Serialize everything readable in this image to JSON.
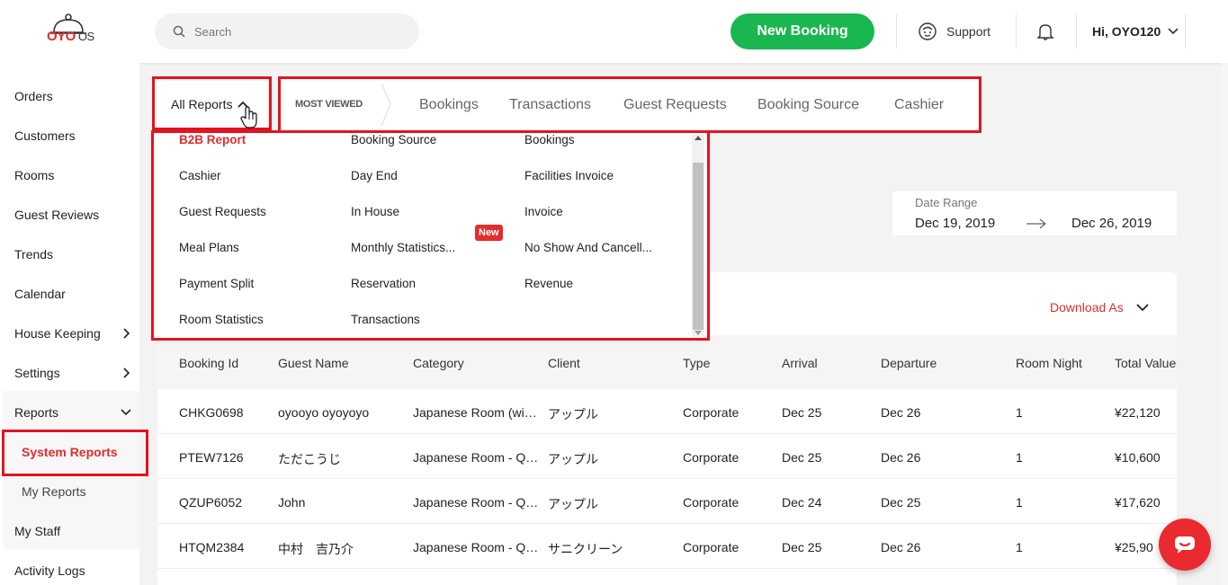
{
  "header": {
    "logo_brand": "OYO",
    "logo_suffix": "OS",
    "search_placeholder": "Search",
    "new_booking_label": "New Booking",
    "support_label": "Support",
    "user_label": "Hi, OYO120"
  },
  "sidebar": {
    "items": [
      {
        "label": "Orders"
      },
      {
        "label": "Customers"
      },
      {
        "label": "Rooms"
      },
      {
        "label": "Guest Reviews"
      },
      {
        "label": "Trends"
      },
      {
        "label": "Calendar"
      },
      {
        "label": "House Keeping"
      },
      {
        "label": "Settings"
      },
      {
        "label": "Reports"
      },
      {
        "label": "System Reports"
      },
      {
        "label": "My Reports"
      },
      {
        "label": "My Staff"
      },
      {
        "label": "Activity Logs"
      }
    ]
  },
  "reports_nav": {
    "all_reports_label": "All Reports",
    "most_viewed_label": "MOST VIEWED",
    "tabs": [
      "Bookings",
      "Transactions",
      "Guest Requests",
      "Booking Source",
      "Cashier"
    ]
  },
  "dropdown": {
    "items": [
      "B2B Report",
      "Booking Source",
      "Bookings",
      "Cashier",
      "Day End",
      "Facilities Invoice",
      "Guest Requests",
      "In House",
      "Invoice",
      "Meal Plans",
      "Monthly Statistics...",
      "No Show And Cancell...",
      "Payment Split",
      "Reservation",
      "Revenue",
      "Room Statistics",
      "Transactions"
    ],
    "new_badge": "New"
  },
  "date_range": {
    "label": "Date Range",
    "from": "Dec 19, 2019",
    "to": "Dec 26, 2019"
  },
  "table": {
    "download_label": "Download As",
    "columns": [
      "Booking Id",
      "Guest Name",
      "Category",
      "Client",
      "Type",
      "Arrival",
      "Departure",
      "Room Night",
      "Total Value"
    ],
    "rows": [
      [
        "CHKG0698",
        "oyooyo oyoyoyo",
        "Japanese Room (wi…",
        "アップル",
        "Corporate",
        "Dec 25",
        "Dec 26",
        "1",
        "¥22,120"
      ],
      [
        "PTEW7126",
        "ただこうじ",
        "Japanese Room - Q…",
        "アップル",
        "Corporate",
        "Dec 25",
        "Dec 26",
        "1",
        "¥10,600"
      ],
      [
        "QZUP6052",
        "John",
        "Japanese Room - Q…",
        "アップル",
        "Corporate",
        "Dec 24",
        "Dec 25",
        "1",
        "¥17,620"
      ],
      [
        "HTQM2384",
        "中村　吉乃介",
        "Japanese Room - Q…",
        "サニクリーン",
        "Corporate",
        "Dec 25",
        "Dec 26",
        "1",
        "¥25,90"
      ]
    ]
  },
  "colors": {
    "brand_red": "#e12d2d",
    "highlight_red": "#e3141f",
    "booking_green": "#1ab64f"
  }
}
